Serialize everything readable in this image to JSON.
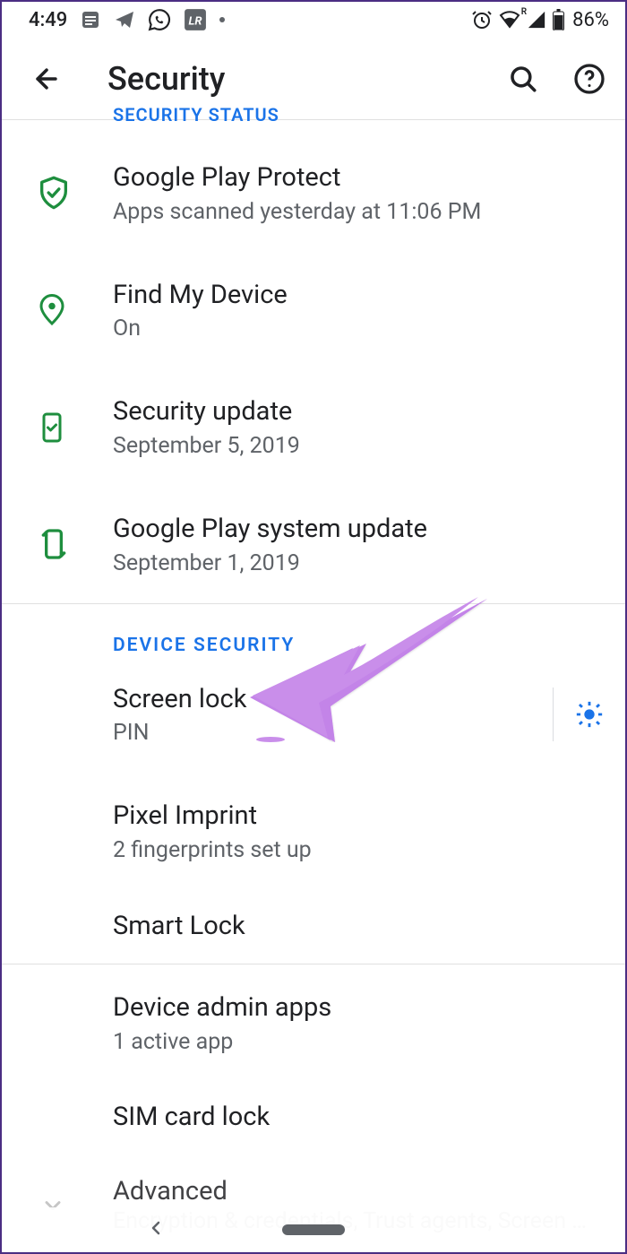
{
  "status": {
    "time": "4:49",
    "battery": "86%"
  },
  "header": {
    "title": "Security"
  },
  "sections": {
    "status_label_cut": "SECURITY STATUS",
    "status_items": [
      {
        "title": "Google Play Protect",
        "sub": "Apps scanned yesterday at 11:06 PM"
      },
      {
        "title": "Find My Device",
        "sub": "On"
      },
      {
        "title": "Security update",
        "sub": "September 5, 2019"
      },
      {
        "title": "Google Play system update",
        "sub": "September 1, 2019"
      }
    ],
    "device_label": "DEVICE SECURITY",
    "device_items": [
      {
        "title": "Screen lock",
        "sub": "PIN",
        "gear": true
      },
      {
        "title": "Pixel Imprint",
        "sub": "2 fingerprints set up"
      },
      {
        "title": "Smart Lock",
        "sub": ""
      }
    ],
    "extra_items": [
      {
        "title": "Device admin apps",
        "sub": "1 active app"
      },
      {
        "title": "SIM card lock",
        "sub": ""
      }
    ],
    "advanced": {
      "title": "Advanced",
      "sub": "Encryption & credentials, Trust agents, Screen pinn.."
    }
  }
}
